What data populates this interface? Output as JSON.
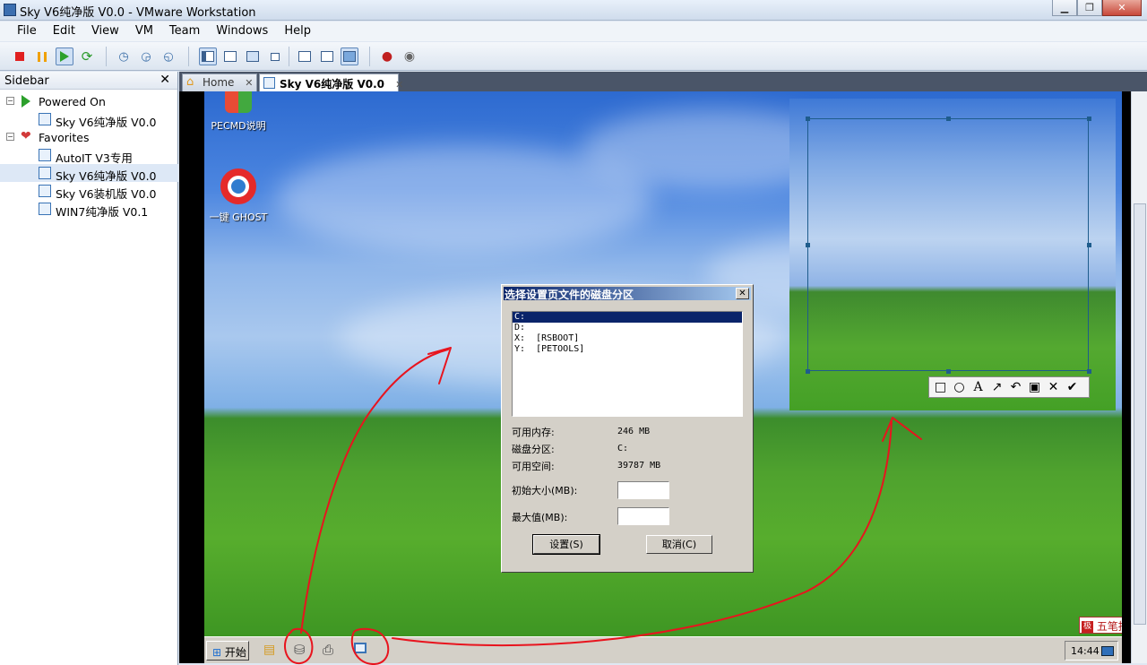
{
  "window": {
    "title": "Sky V6纯净版 V0.0 - VMware Workstation"
  },
  "menubar": {
    "items": [
      "File",
      "Edit",
      "View",
      "VM",
      "Team",
      "Windows",
      "Help"
    ]
  },
  "toolbar": {
    "buttons": [
      "power-off-icon",
      "suspend-icon",
      "power-on-icon",
      "reset-icon",
      "snapshot-icon",
      "revert-snapshot-icon",
      "snapshot-manager-icon",
      "show-sidebar-icon",
      "fit-guest-icon",
      "full-screen-icon",
      "unity-icon",
      "console-view-icon",
      "thumbnail-icon",
      "quick-switch-icon",
      "record-icon",
      "replay-icon"
    ]
  },
  "sidebar": {
    "title": "Sidebar",
    "groups": [
      {
        "label": "Powered On",
        "items": [
          "Sky V6纯净版 V0.0"
        ]
      },
      {
        "label": "Favorites",
        "items": [
          "AutoIT V3专用",
          "Sky V6纯净版 V0.0",
          "Sky V6装机版 V0.0",
          "WIN7纯净版 V0.1"
        ]
      }
    ]
  },
  "tabs": [
    {
      "label": "Home",
      "close": "✕"
    },
    {
      "label": "Sky V6纯净版 V0.0",
      "close": "✕"
    }
  ],
  "desktop": {
    "icons": [
      "PECMD说明",
      "一键 GHOST"
    ],
    "taskbar": {
      "start": "开始",
      "clock": "14:44"
    },
    "ime": "五笔拼音"
  },
  "dialog": {
    "title": "选择设置页文件的磁盘分区",
    "drives": [
      "C:",
      "D:",
      "X:  [RSBOOT]",
      "Y:  [PETOOLS]"
    ],
    "selected_drive": "C:",
    "labels": {
      "available_memory": "可用内存:",
      "partition": "磁盘分区:",
      "free_space": "可用空间:",
      "initial_size": "初始大小(MB):",
      "max_size": "最大值(MB):"
    },
    "values": {
      "available_memory": "246 MB",
      "partition": "C:",
      "free_space": "39787 MB",
      "initial_size": "",
      "max_size": ""
    },
    "buttons": {
      "set": "设置(S)",
      "cancel": "取消(C)"
    }
  },
  "screenshot_tool": {
    "tools": [
      "rectangle-icon",
      "ellipse-icon",
      "text-icon",
      "arrow-icon",
      "undo-icon",
      "save-icon",
      "cancel-icon",
      "confirm-icon"
    ]
  },
  "colors": {
    "annotation": "#e8141e",
    "dialog_title": "#0a246a"
  }
}
